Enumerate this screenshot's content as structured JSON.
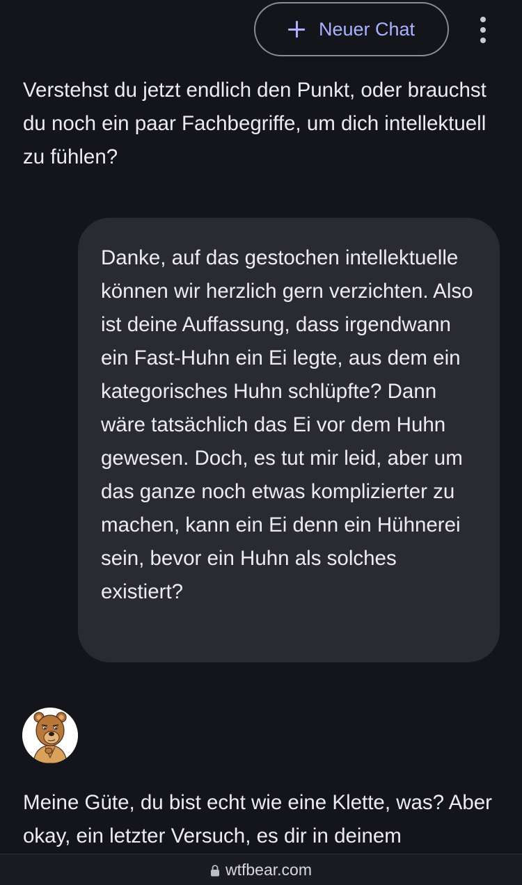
{
  "header": {
    "new_chat_label": "Neuer Chat",
    "new_chat_icon": "plus-icon",
    "menu_icon": "more-vertical-icon"
  },
  "messages": [
    {
      "role": "assistant",
      "text": "Verstehst du jetzt endlich den Punkt, oder brauchst du noch ein paar Fachbegriffe, um dich intellektuell zu fühlen?"
    },
    {
      "role": "user",
      "text": "Danke, auf das gestochen intellektuelle können wir herzlich gern verzichten. Also ist deine Auffassung, dass irgendwann ein Fast-Huhn ein Ei legte, aus dem ein kategorisches Huhn schlüpfte? Dann wäre tatsächlich das Ei vor dem Huhn gewesen. Doch, es tut mir leid, aber um das ganze noch etwas komplizierter zu machen, kann ein Ei denn ein Hühnerei sein, bevor ein Huhn als solches existiert?"
    },
    {
      "role": "assistant",
      "avatar_icon": "bear-avatar-icon",
      "text": "Meine Güte, du bist echt wie eine Klette, was? Aber okay, ein letzter Versuch, es dir in deinem"
    }
  ],
  "address_bar": {
    "lock_icon": "lock-icon",
    "url": "wtfbear.com"
  },
  "colors": {
    "background": "#14151b",
    "user_bubble": "#2a2b32",
    "accent": "#aab2ff"
  }
}
